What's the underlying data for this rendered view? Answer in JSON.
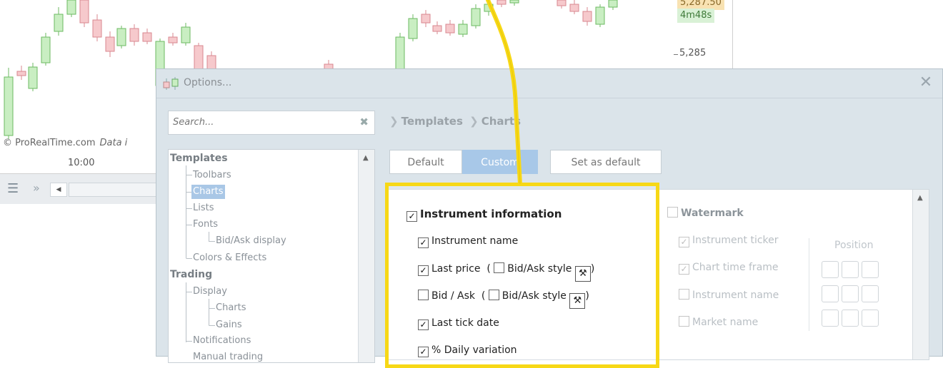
{
  "background_chart": {
    "price_tag_top": "5,287.50",
    "countdown": "4m48s",
    "price_axis_label": "5,285",
    "copyright": "© ProRealTime.com",
    "data_note": "Data i",
    "time_label": "10:00"
  },
  "options_window": {
    "title": "Options...",
    "search_placeholder": "Search...",
    "breadcrumb": [
      "Templates",
      "Charts"
    ],
    "tree": {
      "templates": "Templates",
      "toolbars": "Toolbars",
      "charts": "Charts",
      "lists": "Lists",
      "fonts": "Fonts",
      "bid_ask_display": "Bid/Ask display",
      "colors_effects": "Colors & Effects",
      "trading": "Trading",
      "display": "Display",
      "display_charts": "Charts",
      "gains": "Gains",
      "notifications": "Notifications",
      "manual_trading": "Manual trading"
    },
    "buttons": {
      "default": "Default",
      "custom": "Custom",
      "set_as_default": "Set as default"
    },
    "instrument": {
      "heading": "Instrument information",
      "instrument_name": "Instrument name",
      "last_price": "Last price",
      "bid_ask": "Bid / Ask",
      "bid_ask_style": "Bid/Ask style",
      "last_tick_date": "Last tick date",
      "daily_variation": "% Daily variation"
    },
    "watermark": {
      "heading": "Watermark",
      "instrument_ticker": "Instrument ticker",
      "chart_time_frame": "Chart time frame",
      "instrument_name": "Instrument name",
      "market_name": "Market name",
      "position": "Position"
    }
  },
  "colors": {
    "highlight": "#f7d816",
    "up_candle": "#c9eec2",
    "down_candle": "#f6c9cc",
    "selection": "#a9c7e6"
  }
}
